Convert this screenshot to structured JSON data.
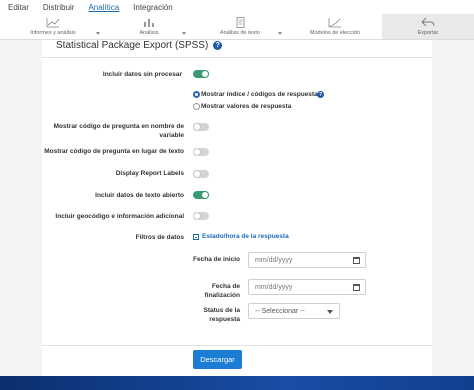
{
  "top_menu": {
    "items": [
      {
        "label": "Editar"
      },
      {
        "label": "Distribuir"
      },
      {
        "label": "Analítica"
      },
      {
        "label": "Integración"
      }
    ]
  },
  "toolbar": {
    "items": [
      {
        "label": "Informes y análisis",
        "icon": "line-chart-icon"
      },
      {
        "label": "Análisis",
        "icon": "bar-chart-icon"
      },
      {
        "label": "Análisis de texto",
        "icon": "document-icon"
      },
      {
        "label": "Modelos de elección",
        "icon": "curve-chart-icon"
      },
      {
        "label": "Exportar",
        "icon": "back-arrow-icon"
      }
    ]
  },
  "main": {
    "title": "Statistical Package Export (SPSS)",
    "include_raw": {
      "label": "Incluir datos sin procesar",
      "on": true
    },
    "radio_options": {
      "option1": "Mostrar índice / códigos de respuesta",
      "option2": "Mostrar valores de respuesta",
      "selected": 1
    },
    "question_code_var": {
      "label": "Mostrar código de pregunta en nombre de variable",
      "on": false
    },
    "question_code_text": {
      "label": "Mostrar código de pregunta en lugar de texto",
      "on": false
    },
    "report_labels": {
      "label": "Display Report Labels",
      "on": false
    },
    "open_text": {
      "label": "Incluir datos de texto abierto",
      "on": true
    },
    "geocode": {
      "label": "Incluir geocódigo e información adicional",
      "on": false
    },
    "filters": {
      "label": "Filtros de datos",
      "link": "Estado/hora de la respuesta"
    },
    "start_date": {
      "label": "Fecha de inicio",
      "placeholder": "mm/dd/yyyy"
    },
    "end_date": {
      "label": "Fecha de finalización",
      "placeholder": "mm/dd/yyyy"
    },
    "status": {
      "label": "Status de la respuesta",
      "value": "-- Seleccionar --"
    },
    "download_button": "Descargar"
  }
}
